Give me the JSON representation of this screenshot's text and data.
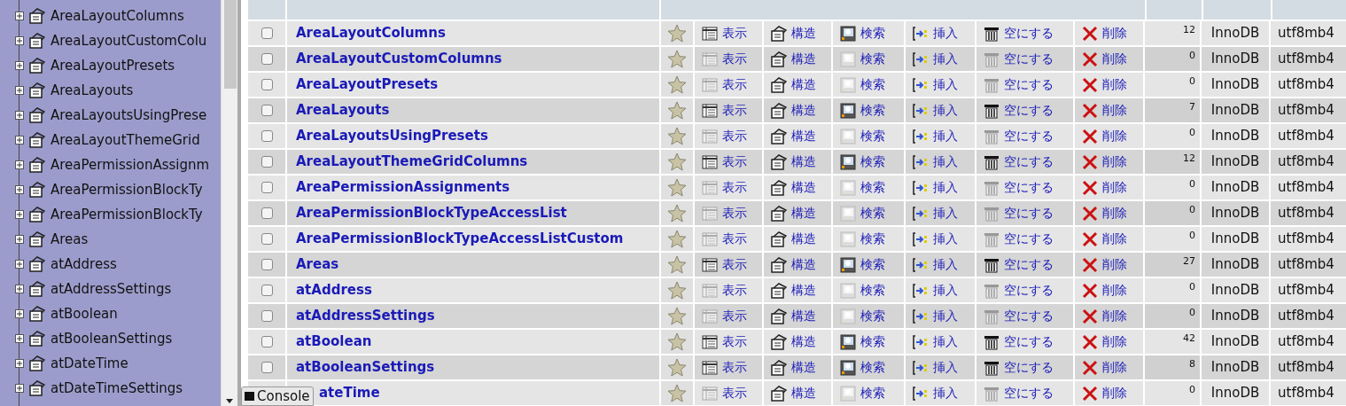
{
  "sidebar": {
    "items": [
      {
        "label": "AreaLayoutColumns"
      },
      {
        "label": "AreaLayoutCustomColu"
      },
      {
        "label": "AreaLayoutPresets"
      },
      {
        "label": "AreaLayouts"
      },
      {
        "label": "AreaLayoutsUsingPrese"
      },
      {
        "label": "AreaLayoutThemeGrid"
      },
      {
        "label": "AreaPermissionAssignm"
      },
      {
        "label": "AreaPermissionBlockTy"
      },
      {
        "label": "AreaPermissionBlockTy"
      },
      {
        "label": "Areas"
      },
      {
        "label": "atAddress"
      },
      {
        "label": "atAddressSettings"
      },
      {
        "label": "atBoolean"
      },
      {
        "label": "atBooleanSettings"
      },
      {
        "label": "atDateTime"
      },
      {
        "label": "atDateTimeSettings"
      }
    ]
  },
  "table": {
    "rows": [
      {
        "checked": false,
        "name": "AreaLayoutColumns",
        "empty": false,
        "count": "12",
        "engine": "InnoDB",
        "collation": "utf8mb4",
        "actions": [
          "表示",
          "構造",
          "検索",
          "挿入",
          "空にする",
          "削除"
        ]
      },
      {
        "checked": false,
        "name": "AreaLayoutCustomColumns",
        "empty": true,
        "count": "0",
        "engine": "InnoDB",
        "collation": "utf8mb4",
        "actions": [
          "表示",
          "構造",
          "検索",
          "挿入",
          "空にする",
          "削除"
        ]
      },
      {
        "checked": false,
        "name": "AreaLayoutPresets",
        "empty": true,
        "count": "0",
        "engine": "InnoDB",
        "collation": "utf8mb4",
        "actions": [
          "表示",
          "構造",
          "検索",
          "挿入",
          "空にする",
          "削除"
        ]
      },
      {
        "checked": false,
        "name": "AreaLayouts",
        "empty": false,
        "count": "7",
        "engine": "InnoDB",
        "collation": "utf8mb4",
        "actions": [
          "表示",
          "構造",
          "検索",
          "挿入",
          "空にする",
          "削除"
        ]
      },
      {
        "checked": false,
        "name": "AreaLayoutsUsingPresets",
        "empty": true,
        "count": "0",
        "engine": "InnoDB",
        "collation": "utf8mb4",
        "actions": [
          "表示",
          "構造",
          "検索",
          "挿入",
          "空にする",
          "削除"
        ]
      },
      {
        "checked": false,
        "name": "AreaLayoutThemeGridColumns",
        "empty": false,
        "count": "12",
        "engine": "InnoDB",
        "collation": "utf8mb4",
        "actions": [
          "表示",
          "構造",
          "検索",
          "挿入",
          "空にする",
          "削除"
        ]
      },
      {
        "checked": false,
        "name": "AreaPermissionAssignments",
        "empty": true,
        "count": "0",
        "engine": "InnoDB",
        "collation": "utf8mb4",
        "actions": [
          "表示",
          "構造",
          "検索",
          "挿入",
          "空にする",
          "削除"
        ]
      },
      {
        "checked": false,
        "name": "AreaPermissionBlockTypeAccessList",
        "empty": true,
        "count": "0",
        "engine": "InnoDB",
        "collation": "utf8mb4",
        "actions": [
          "表示",
          "構造",
          "検索",
          "挿入",
          "空にする",
          "削除"
        ]
      },
      {
        "checked": false,
        "name": "AreaPermissionBlockTypeAccessListCustom",
        "empty": true,
        "count": "0",
        "engine": "InnoDB",
        "collation": "utf8mb4",
        "actions": [
          "表示",
          "構造",
          "検索",
          "挿入",
          "空にする",
          "削除"
        ]
      },
      {
        "checked": false,
        "name": "Areas",
        "empty": false,
        "count": "27",
        "engine": "InnoDB",
        "collation": "utf8mb4",
        "actions": [
          "表示",
          "構造",
          "検索",
          "挿入",
          "空にする",
          "削除"
        ]
      },
      {
        "checked": false,
        "name": "atAddress",
        "empty": true,
        "count": "0",
        "engine": "InnoDB",
        "collation": "utf8mb4",
        "actions": [
          "表示",
          "構造",
          "検索",
          "挿入",
          "空にする",
          "削除"
        ]
      },
      {
        "checked": false,
        "name": "atAddressSettings",
        "empty": true,
        "count": "0",
        "engine": "InnoDB",
        "collation": "utf8mb4",
        "actions": [
          "表示",
          "構造",
          "検索",
          "挿入",
          "空にする",
          "削除"
        ]
      },
      {
        "checked": false,
        "name": "atBoolean",
        "empty": false,
        "count": "42",
        "engine": "InnoDB",
        "collation": "utf8mb4",
        "actions": [
          "表示",
          "構造",
          "検索",
          "挿入",
          "空にする",
          "削除"
        ]
      },
      {
        "checked": false,
        "name": "atBooleanSettings",
        "empty": false,
        "count": "8",
        "engine": "InnoDB",
        "collation": "utf8mb4",
        "actions": [
          "表示",
          "構造",
          "検索",
          "挿入",
          "空にする",
          "削除"
        ]
      },
      {
        "name": "ateTime",
        "empty": true,
        "count": "0",
        "engine": "InnoDB",
        "collation": "utf8mb4",
        "actions": [
          "表示",
          "構造",
          "検索",
          "挿入",
          "空にする",
          "削除"
        ]
      }
    ]
  },
  "console": {
    "label": "Console"
  }
}
